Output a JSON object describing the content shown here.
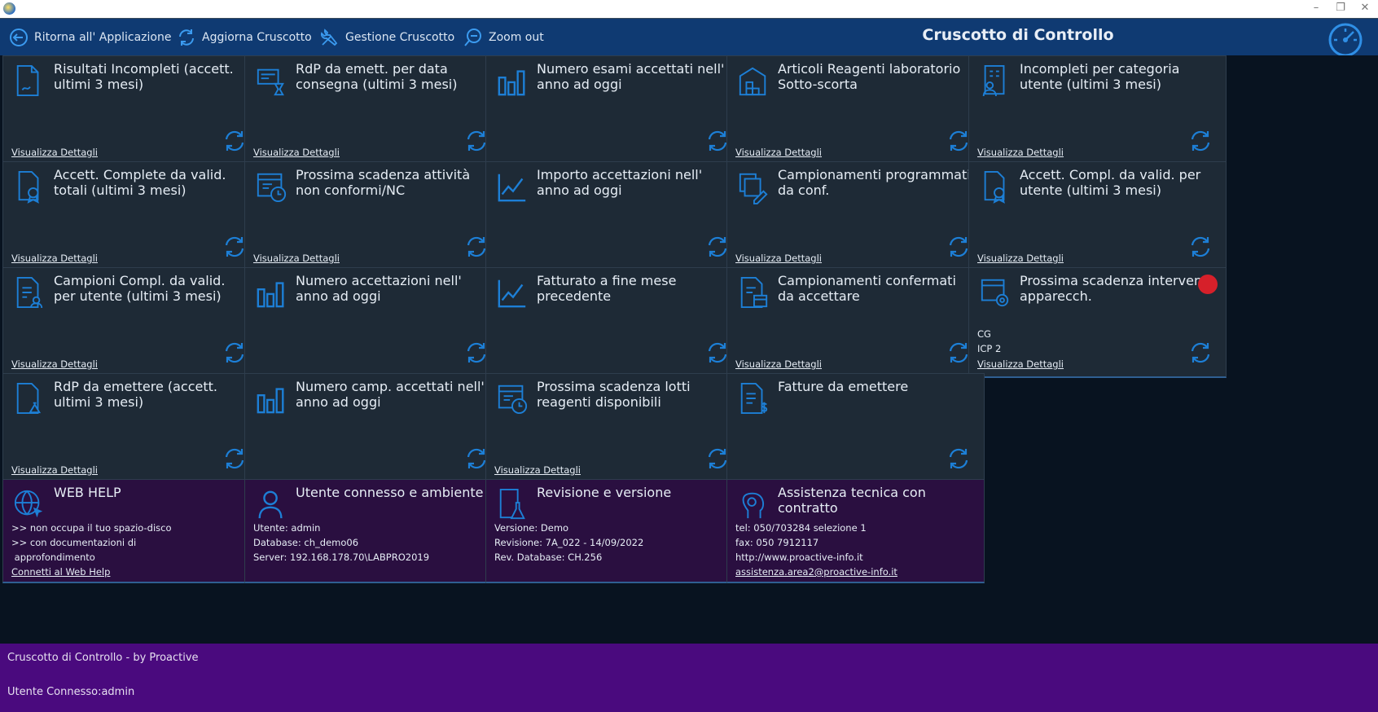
{
  "toolbar": {
    "back_label": "Ritorna all' Applicazione",
    "refresh_label": "Aggiorna Cruscotto",
    "manage_label": "Gestione Cruscotto",
    "zoom_label": "Zoom out",
    "title": "Cruscotto di Controllo"
  },
  "tiles": [
    {
      "title": "Risultati Incompleti (accett. ultimi 3 mesi)",
      "icon": "document-pen-icon",
      "details": "Visualizza Dettagli"
    },
    {
      "title": "RdP da emett. per data consegna (ultimi 3 mesi)",
      "icon": "printer-hourglass-icon",
      "details": "Visualizza Dettagli"
    },
    {
      "title": "Numero esami accettati nell' anno ad oggi",
      "icon": "bar-chart-icon",
      "details": ""
    },
    {
      "title": "Articoli Reagenti laboratorio Sotto-scorta",
      "icon": "warehouse-icon",
      "details": "Visualizza Dettagli"
    },
    {
      "title": "Incompleti per categoria utente (ultimi 3 mesi)",
      "icon": "user-document-icon",
      "details": "Visualizza Dettagli"
    },
    {
      "title": "Accett. Complete da valid. totali (ultimi 3 mesi)",
      "icon": "certificate-icon",
      "details": "Visualizza Dettagli"
    },
    {
      "title": "Prossima scadenza attività non conformi/NC",
      "icon": "calendar-clock-icon",
      "details": "Visualizza Dettagli"
    },
    {
      "title": "Importo accettazioni nell' anno ad oggi",
      "icon": "line-chart-icon",
      "details": ""
    },
    {
      "title": "Campionamenti programmati da conf.",
      "icon": "copy-edit-icon",
      "details": "Visualizza Dettagli"
    },
    {
      "title": "Accett. Compl. da valid. per utente (ultimi 3 mesi)",
      "icon": "certificate-icon",
      "details": "Visualizza Dettagli"
    },
    {
      "title": "Campioni Compl. da valid. per utente (ultimi 3 mesi)",
      "icon": "document-user-icon",
      "details": "Visualizza Dettagli"
    },
    {
      "title": "Numero accettazioni nell' anno ad oggi",
      "icon": "bar-chart-icon",
      "details": ""
    },
    {
      "title": "Fatturato a fine mese precedente",
      "icon": "line-chart-icon",
      "details": ""
    },
    {
      "title": "Campionamenti confermati da accettare",
      "icon": "document-calendar-icon",
      "details": "Visualizza Dettagli"
    },
    {
      "title": "Prossima scadenza interventi apparecch.",
      "icon": "calendar-gear-icon",
      "details": "Visualizza Dettagli",
      "lines": [
        "CG",
        "ICP 2"
      ],
      "alert": true
    },
    {
      "title": "RdP da emettere (accett. ultimi 3 mesi)",
      "icon": "document-stamp-icon",
      "details": "Visualizza Dettagli"
    },
    {
      "title": "Numero camp. accettati nell' anno ad oggi",
      "icon": "bar-chart-icon",
      "details": ""
    },
    {
      "title": "Prossima scadenza lotti reagenti disponibili",
      "icon": "calendar-clock-icon",
      "details": "Visualizza Dettagli"
    },
    {
      "title": "Fatture da emettere",
      "icon": "invoice-dollar-icon",
      "details": ""
    }
  ],
  "info": [
    {
      "title": "WEB HELP",
      "icon": "globe-cursor-icon",
      "lines": [
        ">> non occupa il tuo spazio-disco",
        ">> con documentazioni di",
        " approfondimento"
      ],
      "link": "Connetti al Web Help"
    },
    {
      "title": "Utente connesso e ambiente",
      "icon": "user-icon",
      "lines": [
        "Utente: admin",
        "Database: ch_demo06",
        "Server: 192.168.178.70\\LABPRO2019"
      ],
      "link": ""
    },
    {
      "title": "Revisione e versione",
      "icon": "flask-document-icon",
      "lines": [
        "Versione: Demo",
        "Revisione: 7A_022 - 14/09/2022",
        "Rev. Database: CH.256"
      ],
      "link": ""
    },
    {
      "title": "Assistenza tecnica con contratto",
      "icon": "head-gear-icon",
      "lines": [
        "tel: 050/703284 selezione 1",
        "fax: 050 7912117",
        "http://www.proactive-info.it"
      ],
      "link": "assistenza.area2@proactive-info.it"
    }
  ],
  "footer": {
    "line1": "Cruscotto di Controllo - by Proactive",
    "line2": "Utente Connesso:admin"
  },
  "colors": {
    "accent": "#1d7fd6",
    "tile_bg": "#1e2a36",
    "info_bg": "#2a0f40",
    "footer_bg": "#4a0a7e",
    "toolbar_bg": "#0f3a72"
  }
}
